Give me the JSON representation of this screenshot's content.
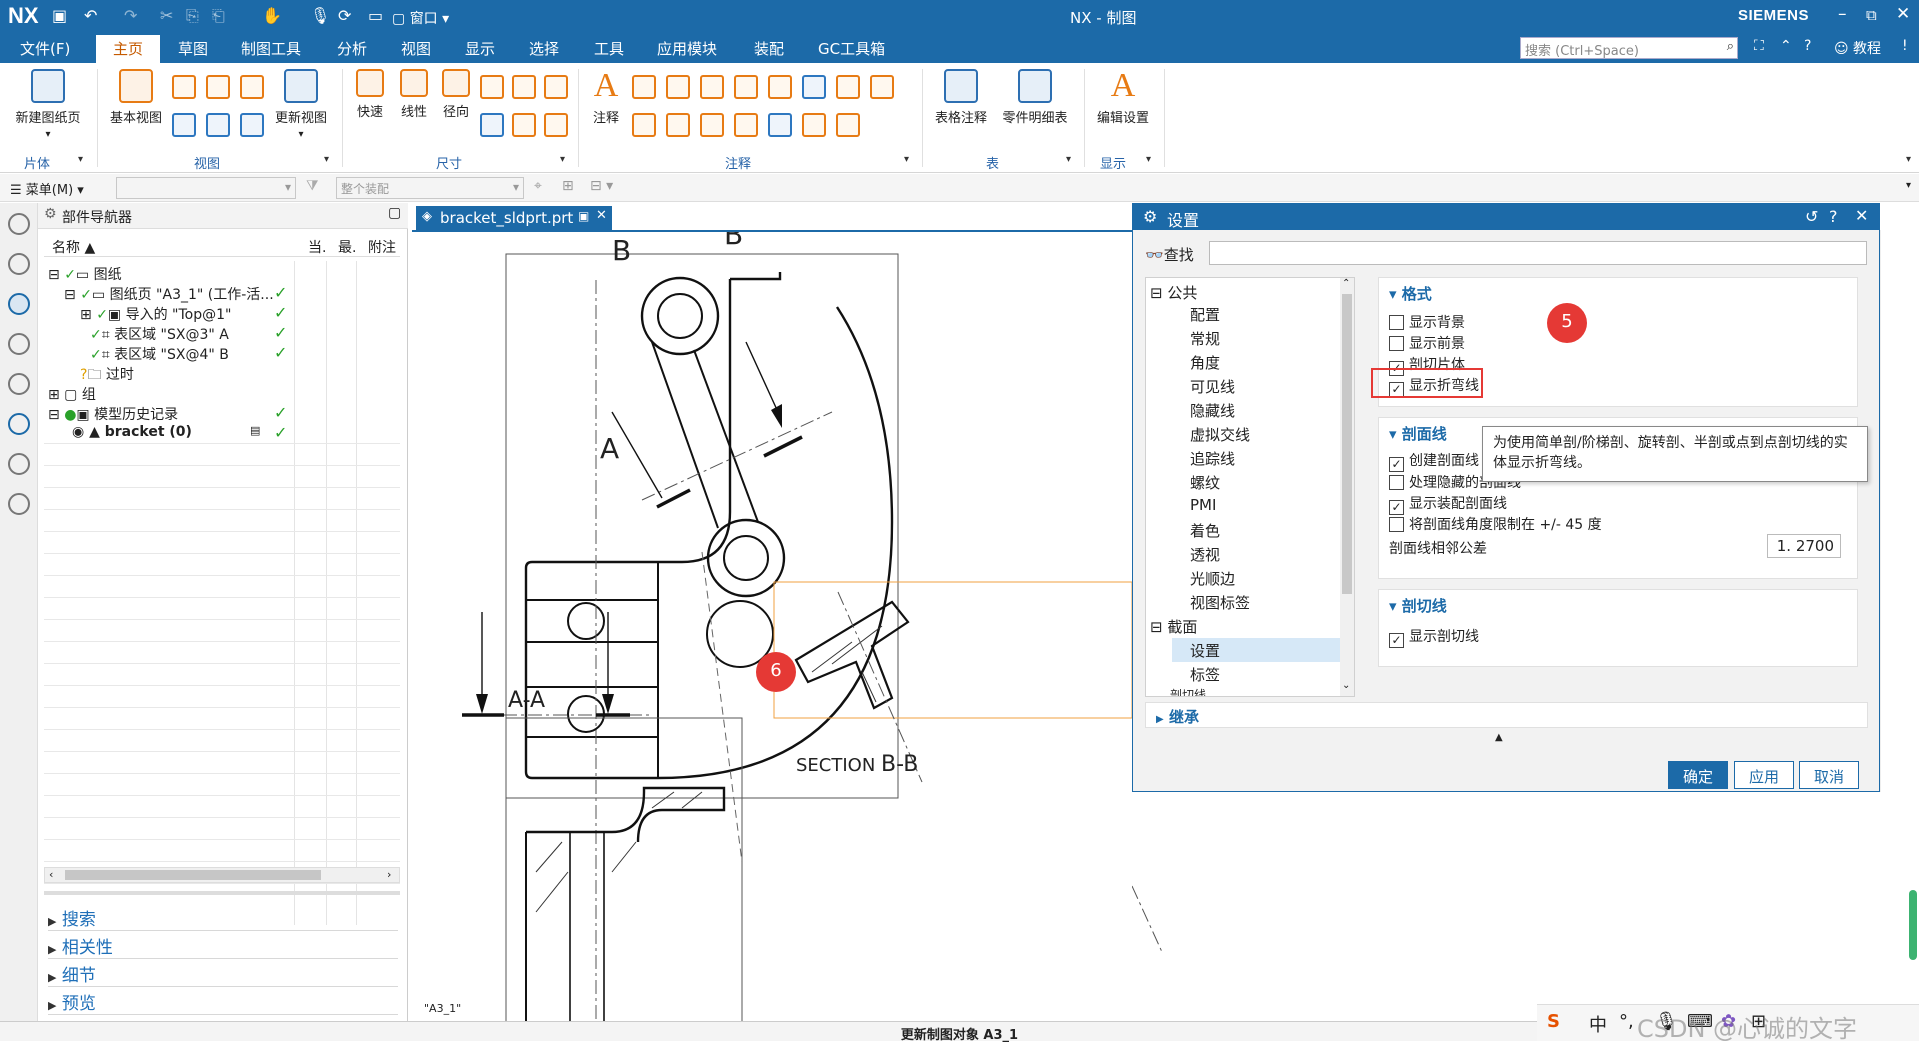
{
  "app": {
    "logo": "NX",
    "title": "NX - 制图",
    "brand": "SIEMENS",
    "quick_access_window": "窗口",
    "window_controls": [
      "_",
      "⧉",
      "✕"
    ]
  },
  "menu": {
    "tabs": [
      "文件(F)",
      "主页",
      "草图",
      "制图工具",
      "分析",
      "视图",
      "显示",
      "选择",
      "工具",
      "应用模块",
      "装配",
      "GC工具箱"
    ],
    "active_tab": "主页",
    "search_placeholder": "搜索 (Ctrl+Space)",
    "tutorial": "教程"
  },
  "ribbon": {
    "new_sheet": "新建图纸页",
    "base_view": "基本视图",
    "update_view": "更新视图",
    "quick": "快速",
    "linear": "线性",
    "radial": "径向",
    "note": "注释",
    "table_note": "表格注释",
    "parts_list": "零件明细表",
    "edit_settings": "编辑设置",
    "groups": [
      "片体",
      "视图",
      "尺寸",
      "注释",
      "表",
      "显示"
    ]
  },
  "cmdbar": {
    "menu_label": "菜单(M)",
    "assembly_filter": "整个装配"
  },
  "part_navigator": {
    "title": "部件导航器",
    "columns": [
      "名称",
      "当.",
      "最.",
      "附注"
    ],
    "rows": [
      {
        "label": "图纸",
        "checked": false
      },
      {
        "label": "图纸页 \"A3_1\" (工作-活...",
        "checked": true
      },
      {
        "label": "导入的 \"Top@1\"",
        "checked": true
      },
      {
        "label": "表区域 \"SX@3\" A",
        "checked": true
      },
      {
        "label": "表区域 \"SX@4\" B",
        "checked": true
      },
      {
        "label": "过时",
        "checked": false
      },
      {
        "label": "组",
        "checked": false
      },
      {
        "label": "模型历史记录",
        "checked": true
      },
      {
        "label": "bracket (0)",
        "checked": true
      }
    ],
    "accordions": [
      "搜索",
      "相关性",
      "细节",
      "预览"
    ]
  },
  "document": {
    "tab_label": "bracket_sldprt.prt",
    "sheet_name": "\"A3_1\"",
    "labels": {
      "b_top": "B",
      "b_left": "B",
      "a_left": "A",
      "a_right": "A",
      "section_aa": "A-A",
      "section_bb_prefix": "SECTION",
      "section_bb": "B-B"
    }
  },
  "dialog": {
    "title": "设置",
    "find_label": "查找",
    "tree": {
      "group_common": "公共",
      "common_items": [
        "配置",
        "常规",
        "角度",
        "可见线",
        "隐藏线",
        "虚拟交线",
        "追踪线",
        "螺纹",
        "PMI",
        "着色",
        "透视",
        "光顺边",
        "视图标签"
      ],
      "group_section": "截面",
      "section_items": [
        "设置",
        "标签"
      ],
      "selected": "设置",
      "partial_item": "剖切线"
    },
    "format_section": {
      "title": "格式",
      "items": [
        {
          "label": "显示背景",
          "checked": false
        },
        {
          "label": "显示前景",
          "checked": false
        },
        {
          "label": "剖切片体",
          "checked": true
        },
        {
          "label": "显示折弯线",
          "checked": true
        }
      ]
    },
    "section_line": {
      "title": "剖面线",
      "items": [
        {
          "label": "创建剖面线",
          "checked": true
        },
        {
          "label": "处理隐藏的剖面线",
          "checked": false
        },
        {
          "label": "显示装配剖面线",
          "checked": true
        },
        {
          "label": "将剖面线角度限制在 +/- 45 度",
          "checked": false
        }
      ],
      "tolerance_label": "剖面线相邻公差",
      "tolerance_value": "1. 2700"
    },
    "cut_line": {
      "title": "剖切线",
      "items": [
        {
          "label": "显示剖切线",
          "checked": true
        }
      ]
    },
    "inherit": "继承",
    "buttons": {
      "ok": "确定",
      "apply": "应用",
      "cancel": "取消"
    }
  },
  "tooltip": "为使用简单剖/阶梯剖、旋转剖、半剖或点到点剖切线的实体显示折弯线。",
  "markers": {
    "m5": "5",
    "m6": "6"
  },
  "status": "更新制图对象 A3_1",
  "ime": {
    "lang": "中"
  },
  "watermark": "CSDN @心诚的文字"
}
